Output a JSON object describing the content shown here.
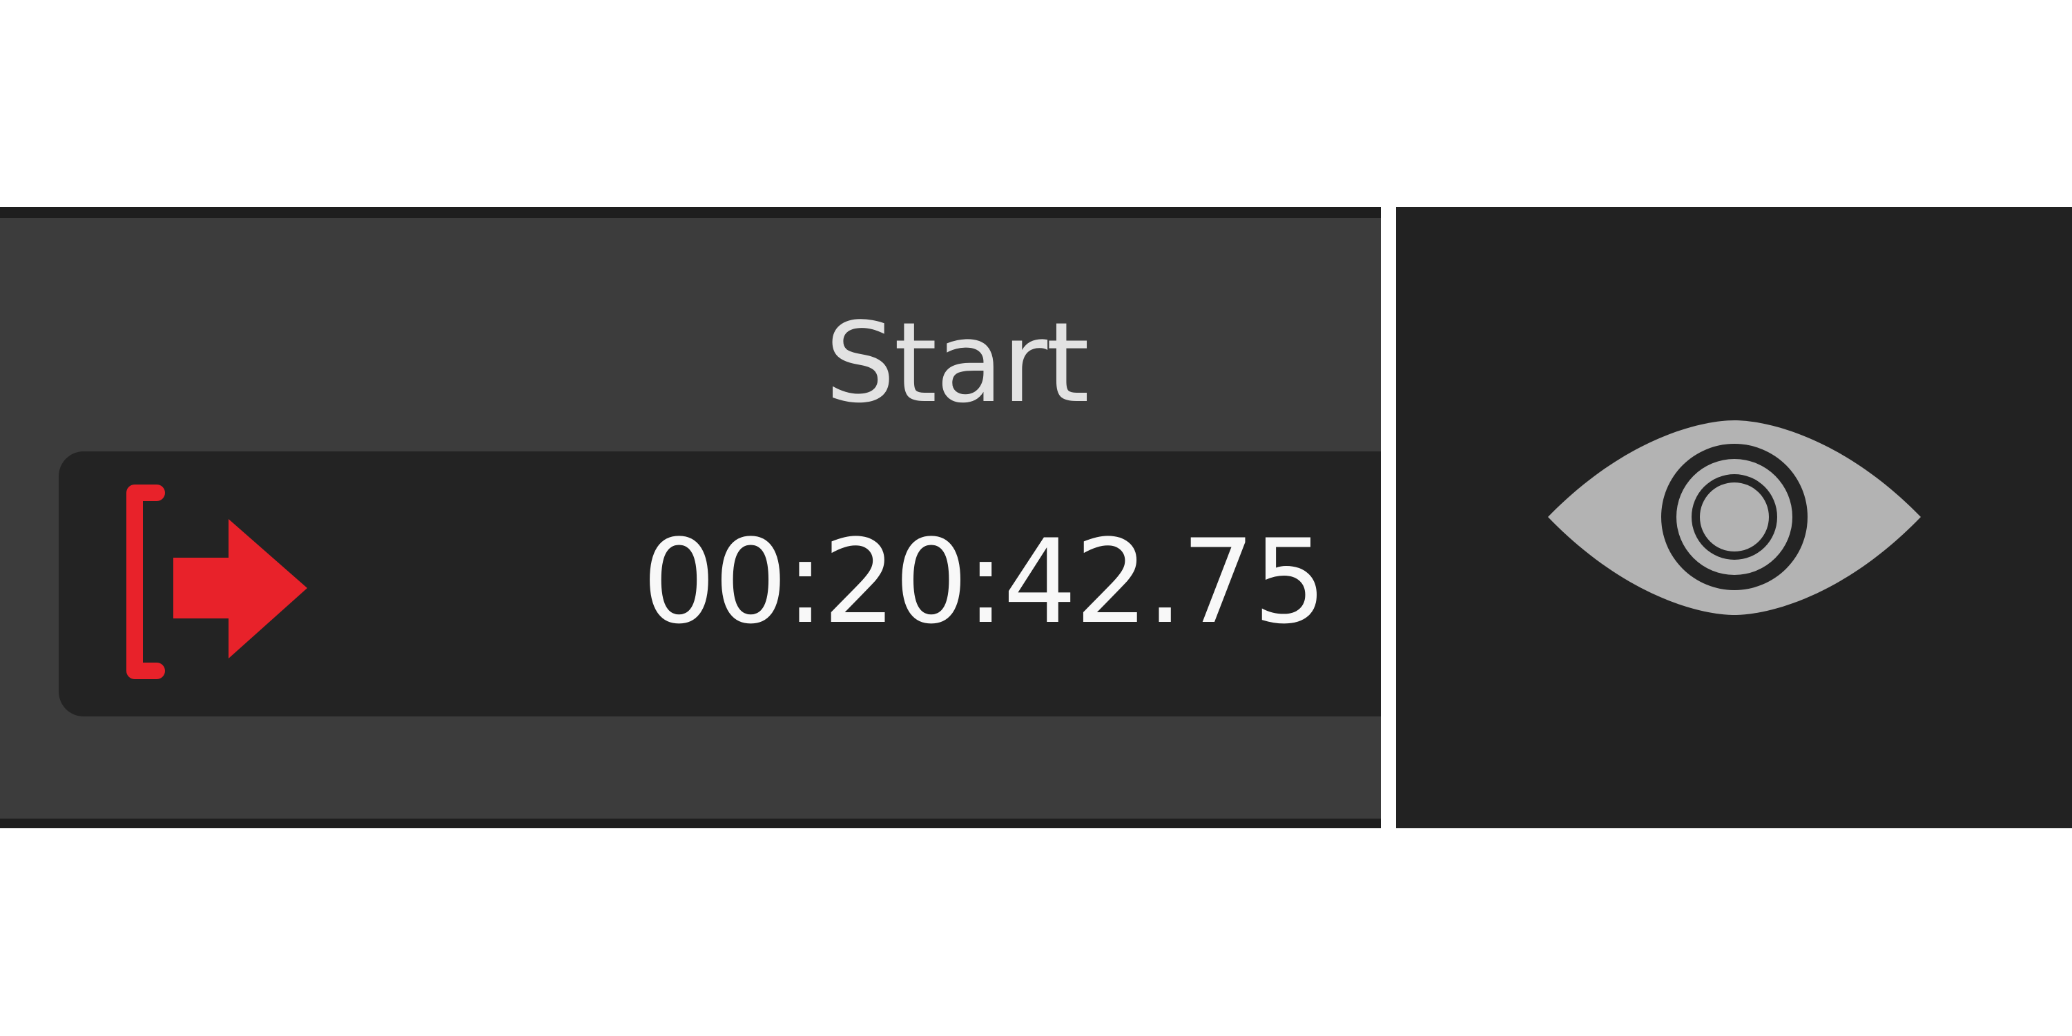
{
  "start": {
    "label": "Start",
    "time": "00:20:42.75",
    "set_start_icon": "bracket-arrow-right-icon"
  },
  "visibility": {
    "icon": "eye-icon"
  },
  "colors": {
    "accent_red": "#e8222a",
    "panel_bg": "#3c3c3c",
    "field_bg": "#232323",
    "eye_gray": "#b3b3b3"
  }
}
